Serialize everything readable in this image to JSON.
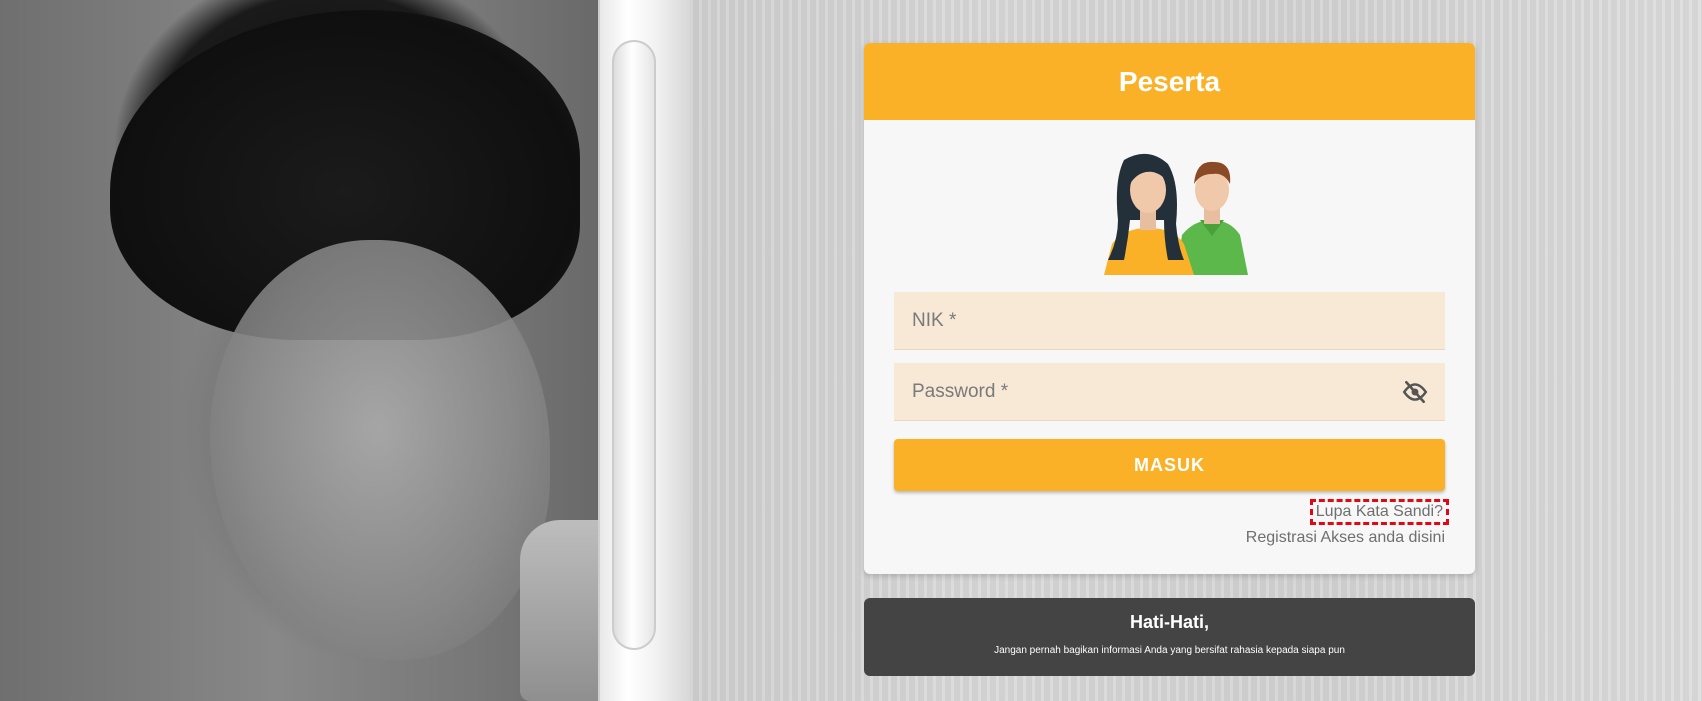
{
  "login": {
    "title": "Peserta",
    "nik_placeholder": "NIK *",
    "password_placeholder": "Password *",
    "submit_label": "MASUK",
    "forgot_link": "Lupa Kata Sandi?",
    "register_link": "Registrasi Akses anda disini"
  },
  "warning": {
    "title": "Hati-Hati,",
    "text": "Jangan pernah bagikan informasi Anda yang bersifat rahasia kepada siapa pun"
  },
  "icons": {
    "avatar": "people-avatar-icon",
    "password_toggle": "eye-off-icon"
  },
  "colors": {
    "accent": "#fbb127",
    "field_bg": "#f8e9d6",
    "warning_bg": "#444444",
    "highlight": "#e30613"
  }
}
